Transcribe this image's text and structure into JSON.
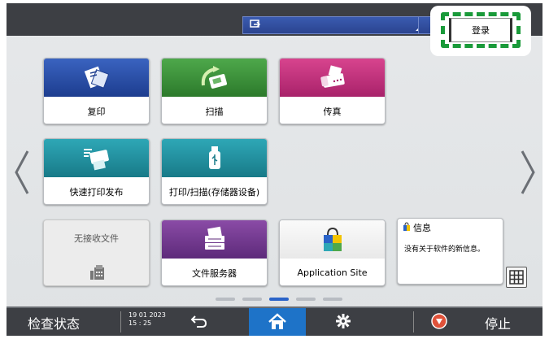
{
  "topbar": {
    "login_label": "登录"
  },
  "tiles": {
    "copy": "复印",
    "scan": "扫描",
    "fax": "传真",
    "quick_print": "快速打印发布",
    "print_scan_storage": "打印/扫描(存储器设备)",
    "no_received_files": "无接收文件",
    "document_server": "文件服务器",
    "application_site": "Application Site"
  },
  "info": {
    "title": "信息",
    "message": "没有关于软件的新信息。"
  },
  "pager": {
    "pages": 5,
    "active_index": 2
  },
  "bottombar": {
    "check_status": "检查状态",
    "date": "19 01 2023",
    "time": "15 : 25",
    "stop": "停止"
  },
  "colors": {
    "accent_home": "#1e73c8",
    "login_highlight": "#1a9a3a"
  }
}
